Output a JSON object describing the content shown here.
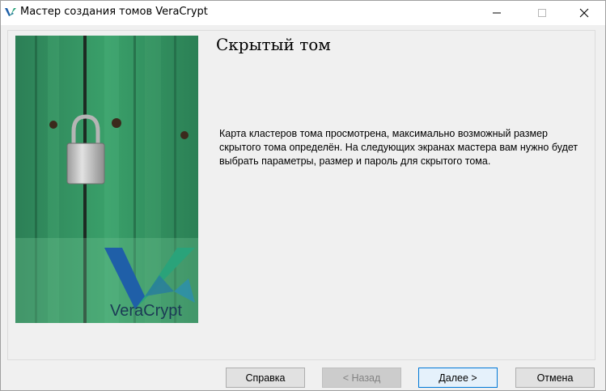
{
  "window": {
    "title": "Мастер создания томов VeraCrypt",
    "app_icon": "veracrypt-icon",
    "controls": [
      "minimize-icon",
      "maximize-icon",
      "close-icon"
    ]
  },
  "side_image": {
    "description_icon": "padlock-door-image",
    "logo_text": "VeraCrypt"
  },
  "page": {
    "heading": "Скрытый том",
    "body": "Карта кластеров тома просмотрена, максимально возможный размер скрытого тома определён. На следующих экранах мастера вам нужно будет выбрать параметры, размер и пароль для скрытого тома."
  },
  "buttons": {
    "help": "Справка",
    "back": "< Назад",
    "next": "Далее >",
    "cancel": "Отмена"
  },
  "colors": {
    "accent": "#0078d7",
    "door_green": "#2f8f5c",
    "logo_blue": "#1f5fa8",
    "logo_teal": "#2aa37a"
  }
}
